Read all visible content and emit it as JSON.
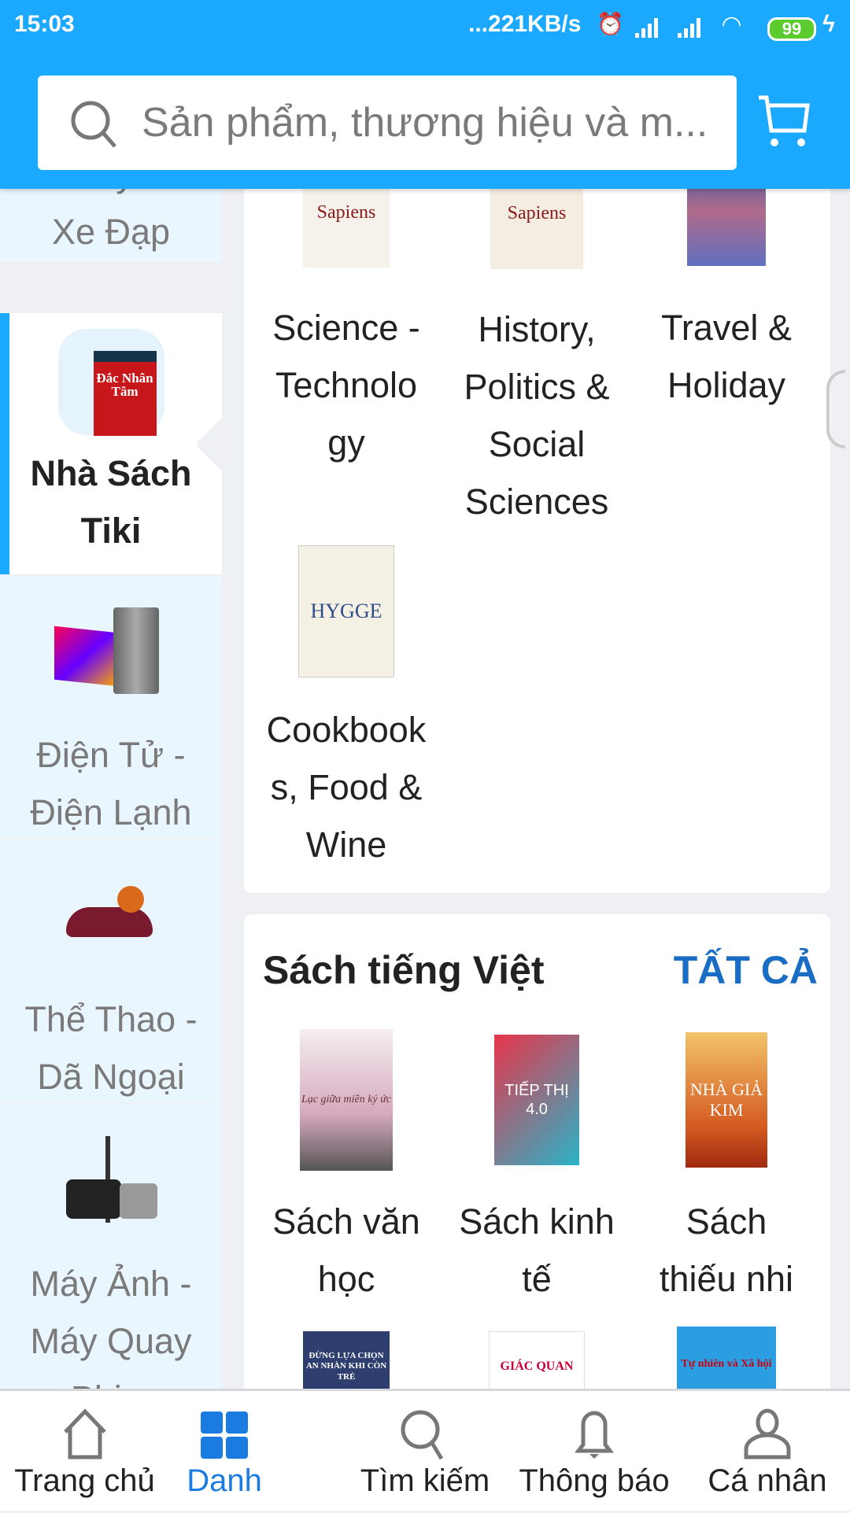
{
  "status_bar": {
    "time": "15:03",
    "net_speed": "...221KB/s",
    "battery": "99"
  },
  "header": {
    "search_placeholder": "Sản phẩm, thương hiệu và m...",
    "accent": "#1ba8ff"
  },
  "sidebar": {
    "items": [
      {
        "label": "Máy - Xe Đạp",
        "selected": false
      },
      {
        "label": "Nhà Sách Tiki",
        "selected": true,
        "thumb": "Đắc Nhân Tâm"
      },
      {
        "label": "Điện Tử - Điện Lạnh",
        "selected": false
      },
      {
        "label": "Thể Thao - Dã Ngoại",
        "selected": false
      },
      {
        "label": "Máy Ảnh - Máy Quay Phim",
        "selected": false
      }
    ]
  },
  "english_books": {
    "items": [
      {
        "label": "Science - Technology",
        "cover": "Sapiens"
      },
      {
        "label": "History, Politics & Social Sciences",
        "cover": "Sapiens"
      },
      {
        "label": "Travel & Holiday",
        "cover": ""
      },
      {
        "label": "Cookbooks, Food & Wine",
        "cover": "HYGGE"
      }
    ]
  },
  "vietnamese_books": {
    "title": "Sách tiếng Việt",
    "see_all": "TẤT CẢ",
    "items": [
      {
        "label": "Sách văn học",
        "cover": "Lạc giữa miền ký ức"
      },
      {
        "label": "Sách kinh tế",
        "cover": "TIẾP THỊ 4.0"
      },
      {
        "label": "Sách thiếu nhi",
        "cover": "NHÀ GIẢ KIM"
      },
      {
        "label": "",
        "cover": "ĐỪNG LỰA CHỌN AN NHÀN KHI CÒN TRẺ"
      },
      {
        "label": "",
        "cover": "GIÁC QUAN"
      },
      {
        "label": "",
        "cover": "Tự nhiên và Xã hội"
      }
    ]
  },
  "bottom_nav": {
    "items": [
      {
        "label": "Trang chủ"
      },
      {
        "label": "Danh",
        "active": true
      },
      {
        "label": "Tìm kiếm"
      },
      {
        "label": "Thông báo"
      },
      {
        "label": "Cá nhân"
      }
    ]
  }
}
